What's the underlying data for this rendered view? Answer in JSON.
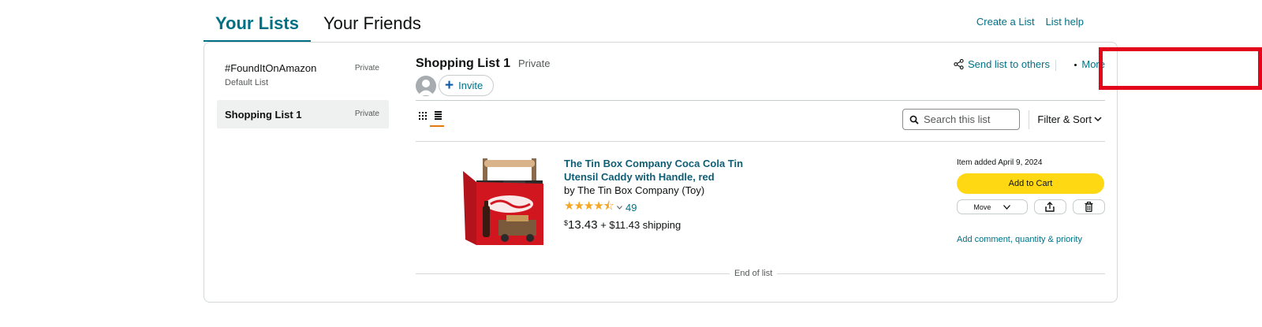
{
  "tabs": [
    {
      "label": "Your Lists"
    },
    {
      "label": "Your Friends"
    }
  ],
  "top_links": {
    "create": "Create a List",
    "help": "List help"
  },
  "sidebar": {
    "lists": [
      {
        "name": "#FoundItOnAmazon",
        "sub": "Default List",
        "privacy": "Private"
      },
      {
        "name": "Shopping List 1",
        "privacy": "Private"
      }
    ]
  },
  "list": {
    "title": "Shopping List 1",
    "privacy": "Private",
    "invite_label": "Invite",
    "send_label": "Send list to others",
    "more_label": "More",
    "search_placeholder": "Search this list",
    "filter_label": "Filter & Sort"
  },
  "item": {
    "title": "The Tin Box Company Coca Cola Tin Utensil Caddy with Handle, red",
    "by": "by The Tin Box Company (Toy)",
    "rating": 4.5,
    "rating_count": "49",
    "price_symbol": "$",
    "price": "13.43",
    "shipping": "+ $11.43 shipping",
    "added": "Item added April 9, 2024",
    "cart_label": "Add to Cart",
    "move_label": "Move",
    "comment_label": "Add comment, quantity & priority"
  },
  "end_label": "End of list",
  "colors": {
    "accent": "#007185",
    "cart": "#ffd814",
    "highlight": "#e3061b",
    "stars": "#f5a623"
  }
}
